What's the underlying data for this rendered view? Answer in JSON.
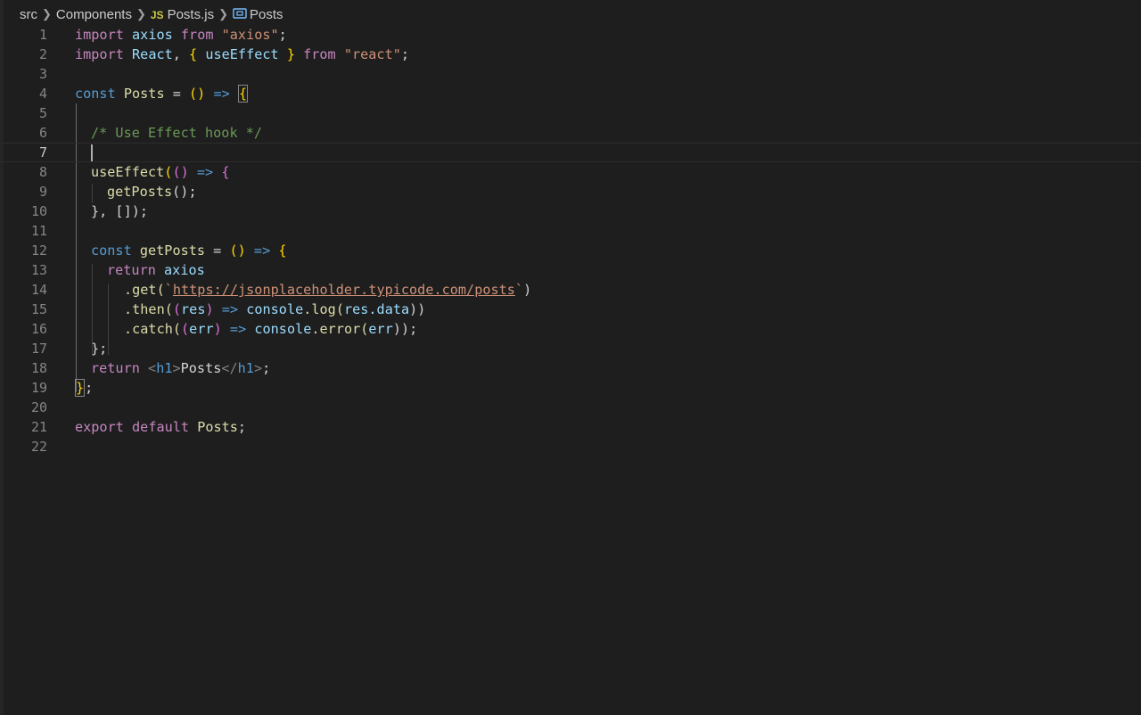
{
  "breadcrumb": {
    "items": [
      "src",
      "Components",
      "Posts.js",
      "Posts"
    ],
    "js_badge": "JS"
  },
  "editor": {
    "current_line": 7,
    "line_numbers": [
      "1",
      "2",
      "3",
      "4",
      "5",
      "6",
      "7",
      "8",
      "9",
      "10",
      "11",
      "12",
      "13",
      "14",
      "15",
      "16",
      "17",
      "18",
      "19",
      "20",
      "21",
      "22"
    ],
    "code": {
      "l1": [
        "import",
        "axios",
        "from",
        "\"axios\"",
        ";"
      ],
      "l2": [
        "import",
        "React",
        "useEffect",
        "from",
        "\"react\""
      ],
      "l4": [
        "const",
        "Posts",
        "=>"
      ],
      "l6": "/* Use Effect hook */",
      "l8": [
        "useEffect",
        "=>"
      ],
      "l9": [
        "getPosts",
        "();"
      ],
      "l10": "}, []);",
      "l12": [
        "const",
        "getPosts",
        "=>"
      ],
      "l13": [
        "return",
        "axios"
      ],
      "l14": [
        ".get(",
        "https://jsonplaceholder.typicode.com/posts",
        ")"
      ],
      "l15": [
        ".then(",
        "res",
        "=>",
        "console",
        ".log(",
        "res",
        ".data",
        "))"
      ],
      "l16": [
        ".catch(",
        "err",
        "=>",
        "console",
        ".error(",
        "err",
        "));"
      ],
      "l17": "};",
      "l18": [
        "return",
        "h1",
        "Posts",
        "h1"
      ],
      "l19": "};",
      "l21": [
        "export",
        "default",
        "Posts"
      ]
    }
  }
}
